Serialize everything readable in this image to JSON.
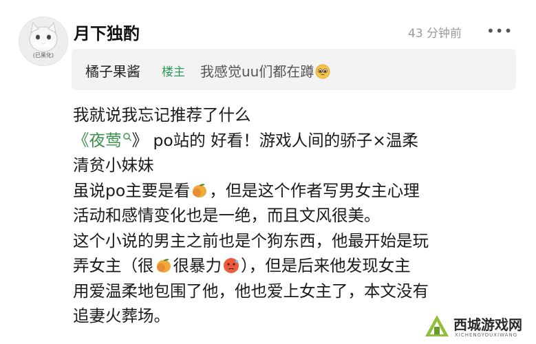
{
  "comment": {
    "avatar_caption": "(已黑化)",
    "username": "月下独酌",
    "timestamp": "43 分钟前",
    "more_icon": "more-dots-icon",
    "quote": {
      "author": "橘子果酱",
      "badge": "楼主",
      "text": "我感觉uu们都在蹲",
      "emoji": "pleading-face-icon"
    },
    "body": {
      "line1": "我就说我忘记推荐了什么",
      "line2_open": "《",
      "line2_book": "夜莺",
      "line2_close": "》 po站的 好看！游戏人间的骄子×温柔",
      "line3": "清贫小妹妹",
      "line4_a": "虽说po主要是看",
      "line4_b": "，但是这个作者写男女主心理",
      "line5": "活动和感情变化也是一绝，而且文风很美。",
      "line6": "这个小说的男主之前也是个狗东西，他最开始是玩",
      "line7_a": "弄女主（很",
      "line7_b": "很暴力",
      "line7_c": "），但是后来他发现女主",
      "line8": "用爱温柔地包围了他，他也爱上女主了，本文没有",
      "line9": "追妻火葬场。"
    }
  },
  "watermark": {
    "title": "西城游戏网",
    "subtitle": "XICHENGYOUXIWANG"
  },
  "colors": {
    "accent_green": "#3a8f4a",
    "badge_green": "#2f9a5a",
    "quote_bg": "#f3f3f3",
    "muted_text": "#9a9a9a"
  }
}
